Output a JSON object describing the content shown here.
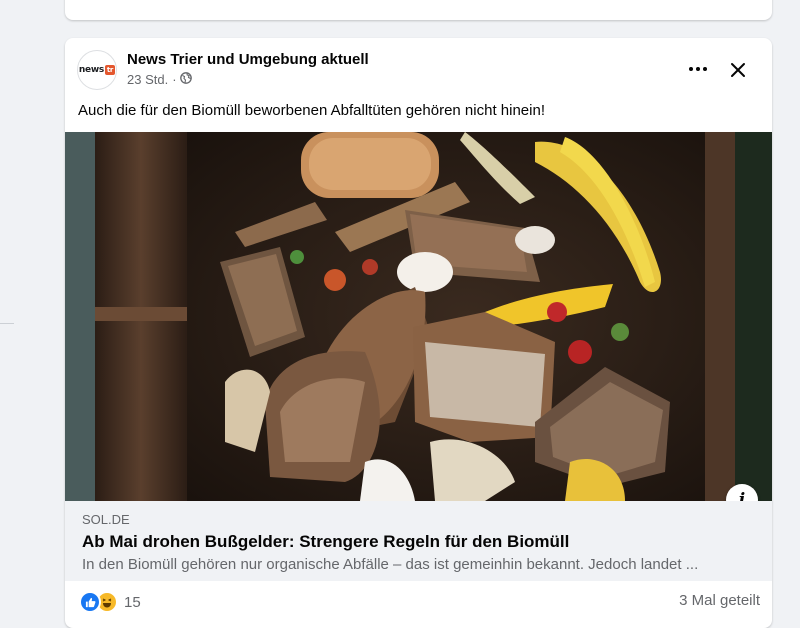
{
  "post": {
    "page_name": "News Trier und Umgebung aktuell",
    "avatar_text": "news",
    "avatar_mark": "tr",
    "timestamp": "23 Std.",
    "separator": "·",
    "caption": "Auch die für den Biomüll beworbenen Abfalltüten gehören nicht hinein!",
    "icons": {
      "audience": "globe-icon",
      "more": "more-icon",
      "close": "close-icon",
      "info": "info-icon"
    },
    "info_glyph": "i"
  },
  "link": {
    "domain": "SOL.DE",
    "title": "Ab Mai drohen Bußgelder: Strengere Regeln für den Biomüll",
    "description": "In den Biomüll gehören nur organische Abfälle – das ist gemeinhin bekannt. Jedoch landet ..."
  },
  "footer": {
    "reaction_types": [
      "like",
      "haha"
    ],
    "reaction_count": "15",
    "shares": "3 Mal geteilt"
  },
  "colors": {
    "accent": "#1877f2",
    "haha": "#f7b928",
    "secondary_text": "#65676b",
    "background": "#f0f2f5"
  }
}
